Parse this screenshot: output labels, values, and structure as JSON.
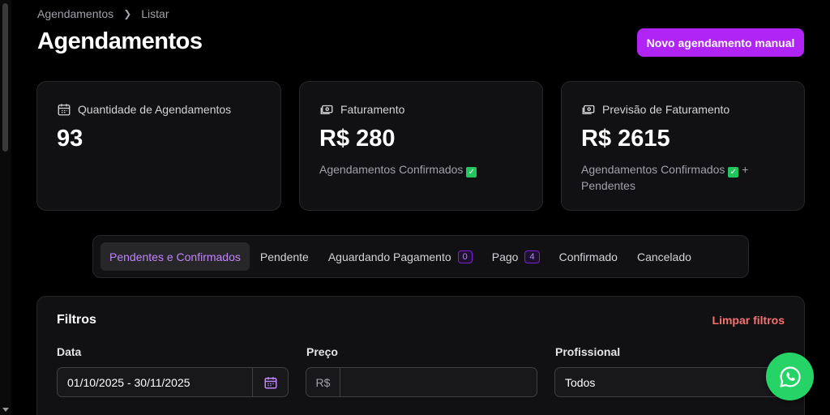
{
  "breadcrumb": {
    "items": [
      "Agendamentos",
      "Listar"
    ]
  },
  "page": {
    "title": "Agendamentos"
  },
  "actions": {
    "new_manual": "Novo agendamento manual"
  },
  "cards": [
    {
      "label": "Quantidade de Agendamentos",
      "value": "93",
      "desc": ""
    },
    {
      "label": "Faturamento",
      "value": "R$ 280",
      "desc": "Agendamentos Confirmados"
    },
    {
      "label": "Previsão de Faturamento",
      "value": "R$ 2615",
      "desc": "Agendamentos Confirmados",
      "desc_suffix": "+",
      "desc_line2": "Pendentes"
    }
  ],
  "tabs": [
    {
      "label": "Pendentes e Confirmados",
      "active": true
    },
    {
      "label": "Pendente"
    },
    {
      "label": "Aguardando Pagamento",
      "count": "0"
    },
    {
      "label": "Pago",
      "count": "4"
    },
    {
      "label": "Confirmado"
    },
    {
      "label": "Cancelado"
    }
  ],
  "filters": {
    "title": "Filtros",
    "clear": "Limpar filtros",
    "date": {
      "label": "Data",
      "value": "01/10/2025 - 30/11/2025"
    },
    "price": {
      "label": "Preço",
      "prefix": "R$",
      "value": ""
    },
    "professional": {
      "label": "Profissional",
      "value": "Todos"
    }
  },
  "colors": {
    "accent": "#b025f5",
    "danger": "#f87171",
    "whatsapp": "#25d366"
  }
}
